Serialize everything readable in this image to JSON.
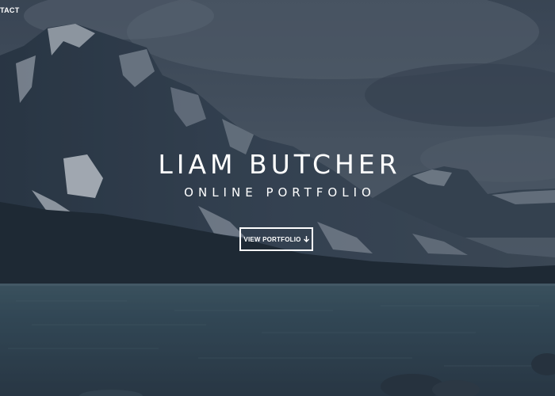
{
  "nav": {
    "contact_label": "TACT"
  },
  "hero": {
    "title": "LIAM BUTCHER",
    "subtitle": "ONLINE PORTFOLIO",
    "cta_label": "VIEW PORTFOLIO",
    "cta_icon": "arrow-down-icon",
    "cta_icon_glyph": "🡓"
  },
  "colors": {
    "sky": "#4e5868",
    "mountain": "#3a4656",
    "snow": "#c9cfd8",
    "forest": "#1f2933",
    "lake": "#3c5462",
    "text": "#ffffff"
  }
}
